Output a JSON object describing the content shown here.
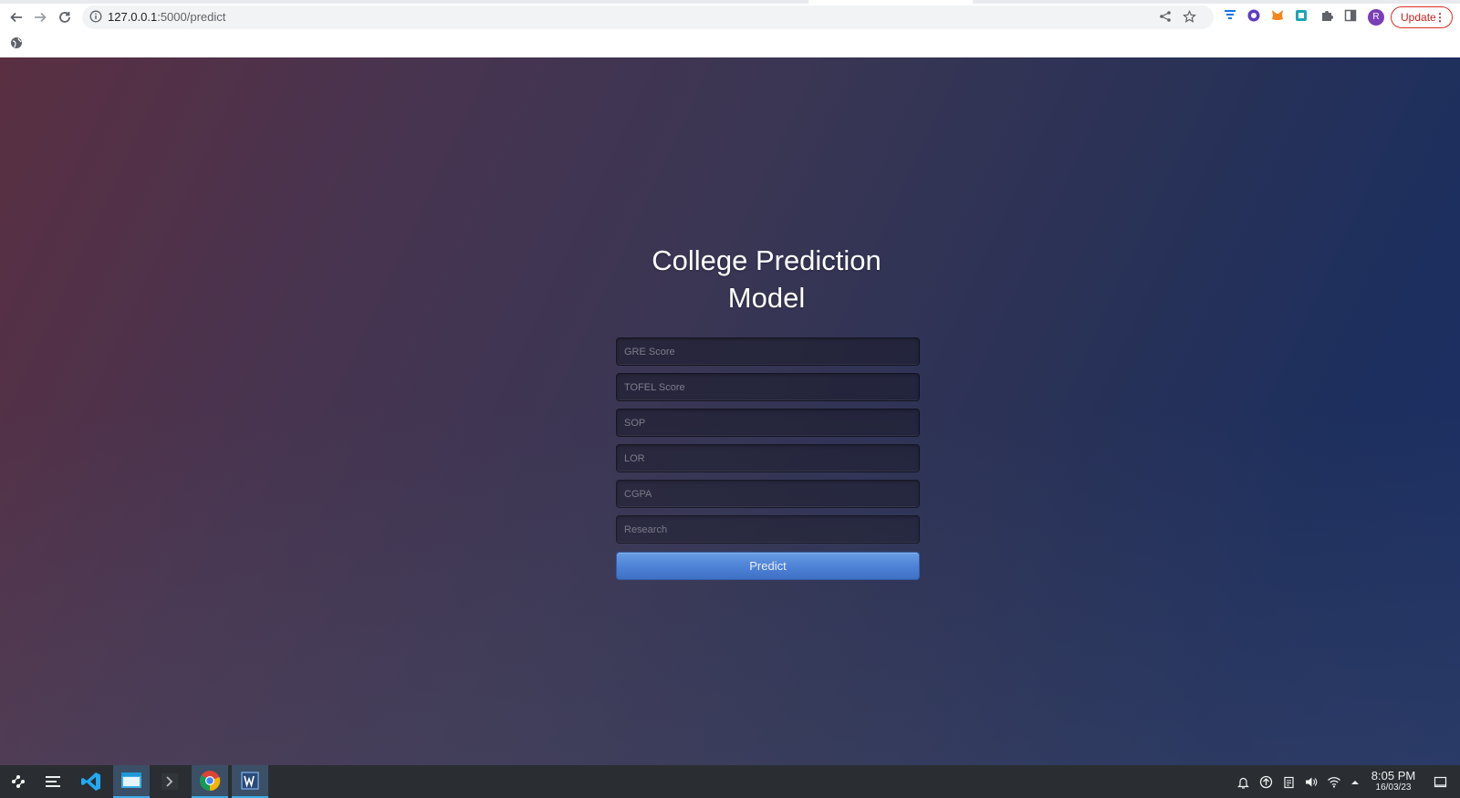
{
  "browser": {
    "url_host": "127.0.0.1",
    "url_path": ":5000/predict",
    "profile_initial": "R",
    "update_label": "Update",
    "icons": [
      "back-icon",
      "forward-icon",
      "reload-icon",
      "site-info-icon",
      "share-icon",
      "star-icon",
      "extension-filter-icon",
      "extension-circle-icon",
      "metamask-icon",
      "extension-square-icon",
      "puzzle-icon",
      "sidepanel-icon",
      "menu-dots-icon",
      "bookmark-globe-icon"
    ]
  },
  "page": {
    "title_line1": "College Prediction",
    "title_line2": "Model",
    "fields": {
      "gre": "GRE Score",
      "tofel": "TOFEL Score",
      "sop": "SOP",
      "lor": "LOR",
      "cgpa": "CGPA",
      "research": "Research"
    },
    "predict_label": "Predict",
    "colors": {
      "button": "#4a86e3",
      "bg_left": "#5a2f42",
      "bg_right": "#1b3064"
    }
  },
  "taskbar": {
    "time": "8:05 PM",
    "date": "16/03/23",
    "apps": [
      "app-launcher-icon",
      "task-manager-icon",
      "vscode-icon",
      "file-manager-icon",
      "terminal-icon",
      "chrome-icon",
      "wps-writer-icon"
    ],
    "tray": [
      "notifications-icon",
      "updates-icon",
      "clipboard-icon",
      "volume-icon",
      "wifi-icon",
      "tray-expand-icon",
      "show-desktop-icon"
    ]
  }
}
